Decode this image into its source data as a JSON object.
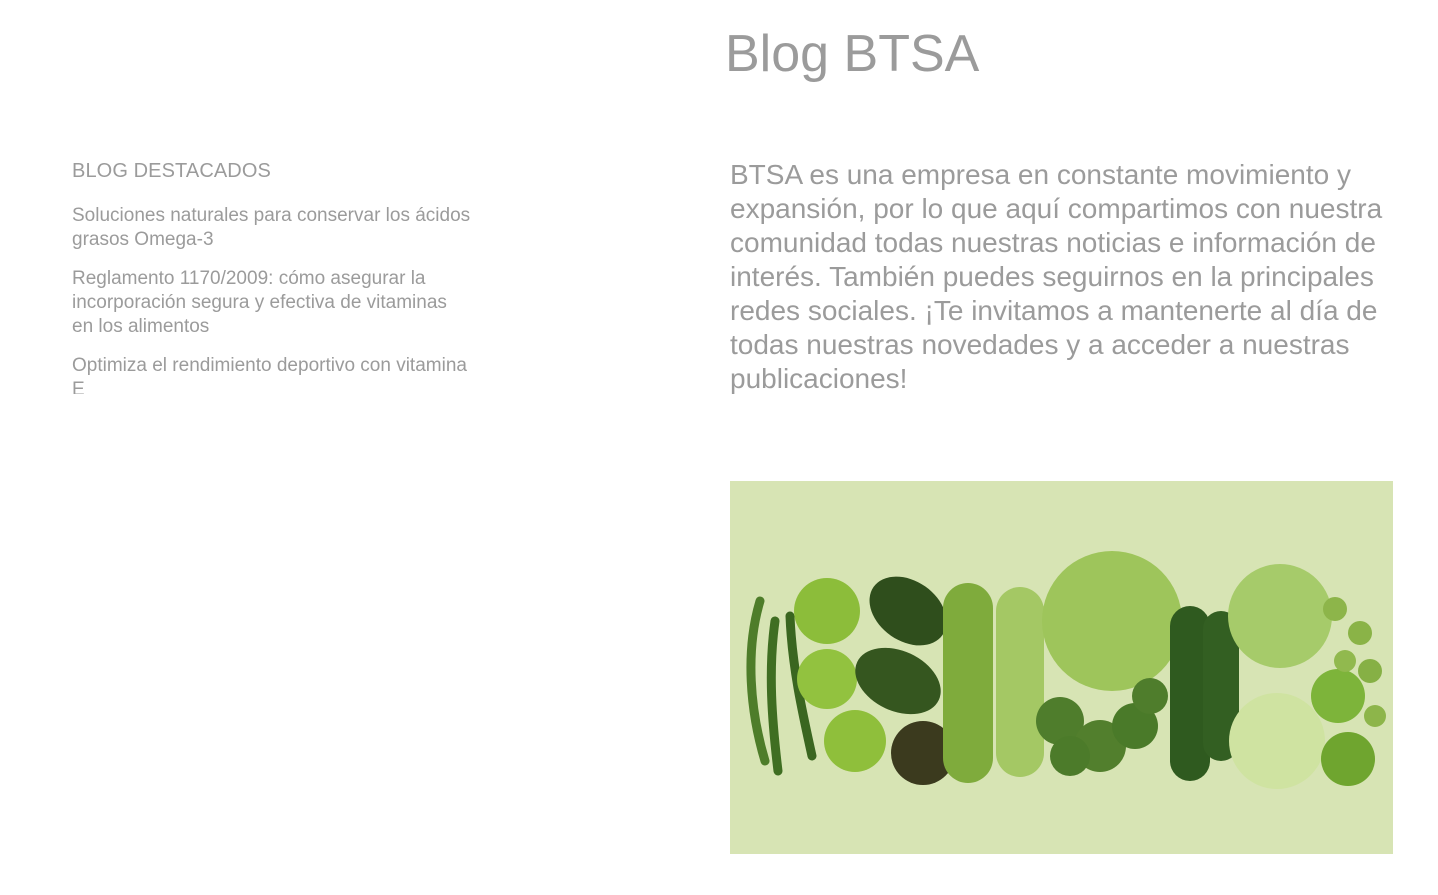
{
  "header": {
    "title": "Blog BTSA"
  },
  "sidebar": {
    "heading": "BLOG DESTACADOS",
    "items": [
      {
        "label": "Soluciones naturales para conservar los ácidos grasos Omega-3"
      },
      {
        "label": "Reglamento 1170/2009: cómo asegurar la incorporación segura y efectiva de vitaminas en los alimentos"
      },
      {
        "label": "Optimiza el rendimiento deportivo con vitamina E"
      }
    ]
  },
  "main": {
    "intro": "BTSA es una empresa en constante movimiento y expansión, por lo que aquí compartimos con nuestra comunidad todas nuestras noticias e información de interés. También puedes seguirnos en la principales redes sociales. ¡Te invitamos a mantenerte al día de todas nuestras novedades y a acceder a nuestras publicaciones!"
  },
  "colors": {
    "text": "#9b9b9b",
    "image_background": "#d7e4b4",
    "vegetable_green": "#6e9a35"
  }
}
